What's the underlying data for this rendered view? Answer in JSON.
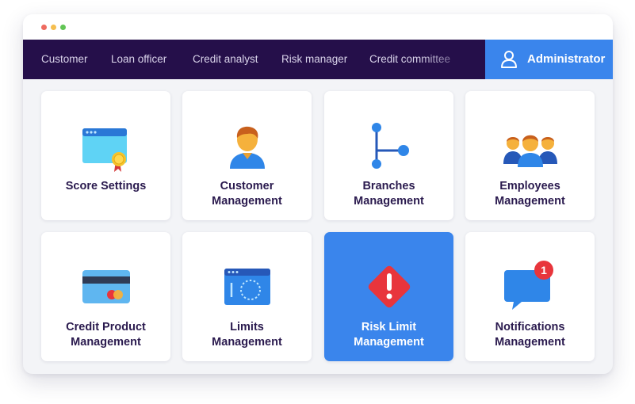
{
  "nav": {
    "items": [
      {
        "label": "Customer"
      },
      {
        "label": "Loan officer"
      },
      {
        "label": "Credit analyst"
      },
      {
        "label": "Risk manager"
      },
      {
        "label": "Credit committee"
      }
    ],
    "admin_label": "Administrator",
    "admin_icon": "user-icon"
  },
  "cards": [
    {
      "line1": "Score Settings",
      "line2": "",
      "icon": "settings-certificate-icon"
    },
    {
      "line1": "Customer",
      "line2": "Management",
      "icon": "customer-icon"
    },
    {
      "line1": "Branches",
      "line2": "Management",
      "icon": "branches-icon"
    },
    {
      "line1": "Employees",
      "line2": "Management",
      "icon": "employees-icon"
    },
    {
      "line1": "Credit Product",
      "line2": "Management",
      "icon": "credit-card-icon"
    },
    {
      "line1": "Limits",
      "line2": "Management",
      "icon": "limits-icon"
    },
    {
      "line1": "Risk Limit",
      "line2": "Management",
      "icon": "warning-icon",
      "active": true
    },
    {
      "line1": "Notifications",
      "line2": "Management",
      "icon": "notification-icon",
      "badge": "1"
    }
  ],
  "colors": {
    "nav_bg": "#250f4a",
    "accent": "#3a85ec",
    "badge": "#e8353c",
    "text": "#2a1a4e"
  }
}
